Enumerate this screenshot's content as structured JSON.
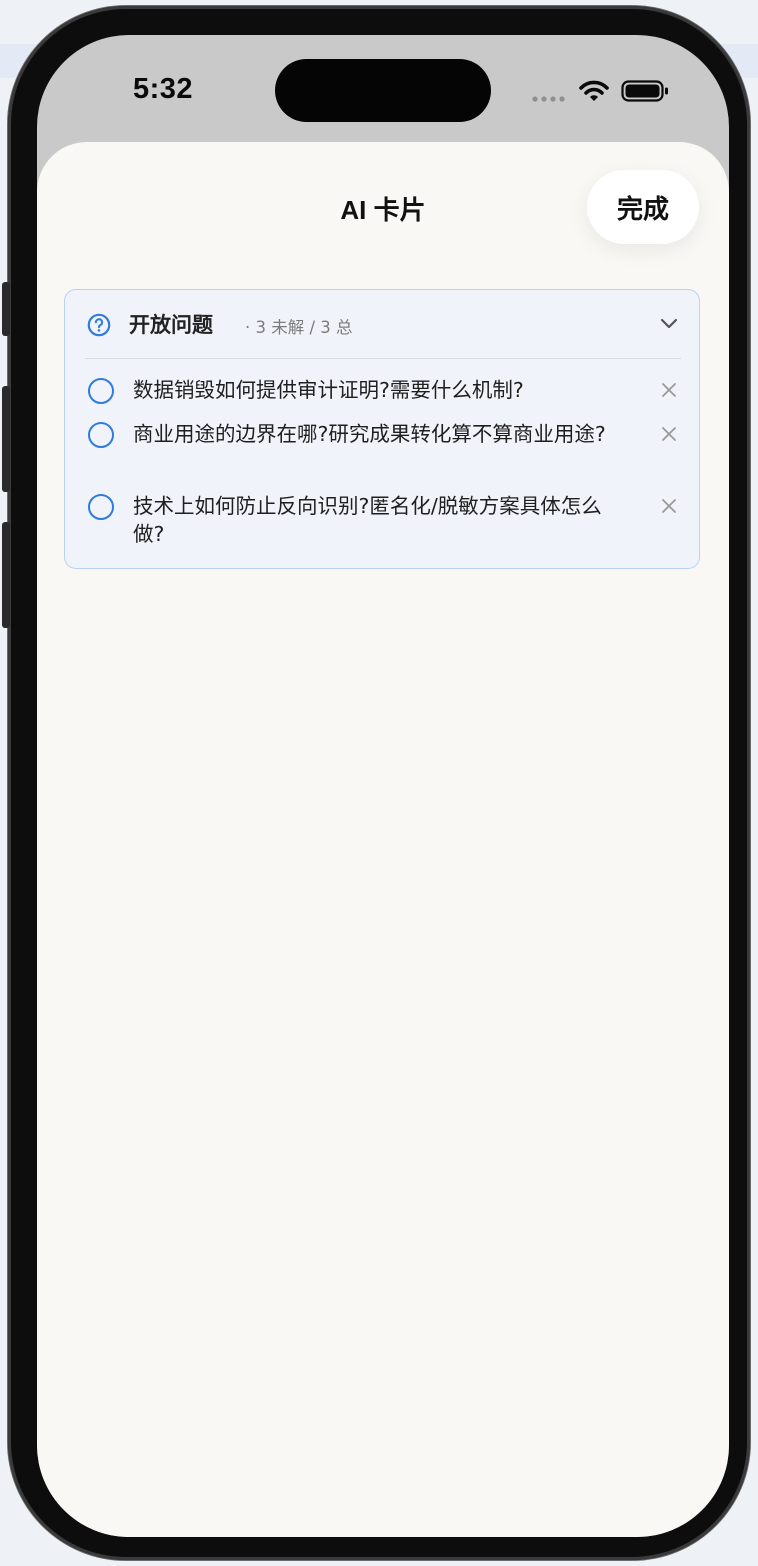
{
  "status": {
    "time": "5:32"
  },
  "sheet": {
    "title": "AI 卡片",
    "done_label": "完成"
  },
  "card": {
    "title": "开放问题",
    "meta": "· 3 未解 / 3 总",
    "icon": "question-circle-icon",
    "expand_icon": "chevron-down-icon",
    "questions": [
      {
        "text": "数据销毁如何提供审计证明?需要什么机制?"
      },
      {
        "text": "商业用途的边界在哪?研究成果转化算不算商业用途?"
      },
      {
        "text": "技术上如何防止反向识别?匿名化/脱敏方案具体怎么做?"
      }
    ]
  },
  "colors": {
    "accent": "#2f7be0",
    "card_bg": "#f1f3fa",
    "card_border": "#b9d2f3",
    "sheet_bg": "#f9f8f5"
  }
}
